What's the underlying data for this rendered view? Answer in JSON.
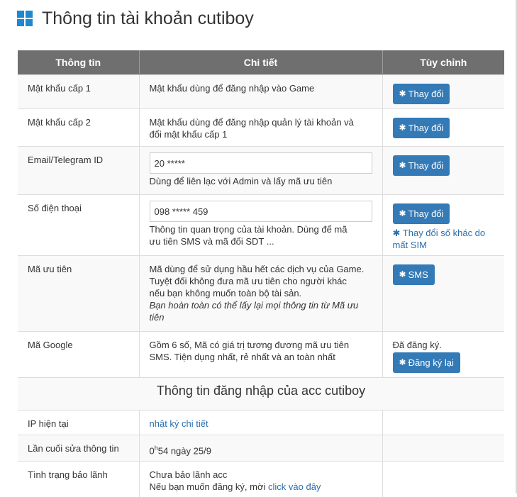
{
  "page": {
    "title": "Thông tin tài khoản cutiboy"
  },
  "columns": [
    "Thông tin",
    "Chi tiết",
    "Tùy chỉnh"
  ],
  "rows": [
    {
      "label": "Mật khẩu cấp 1",
      "detail": "Mật khẩu dùng để đăng nhập vào Game",
      "button": "Thay đổi"
    },
    {
      "label": "Mật khẩu cấp 2",
      "detail_lines": [
        "Mật khẩu dùng để đăng nhập quản lý tài khoản và",
        "đổi mật khẩu cấp 1"
      ],
      "button": "Thay đổi"
    },
    {
      "label": "Email/Telegram ID",
      "input_value": "20 *****",
      "detail": "Dùng để liên lạc với Admin và lấy mã ưu tiên",
      "button": "Thay đổi"
    },
    {
      "label": "Số điện thoại",
      "input_value": "098 ***** 459",
      "detail_lines": [
        "Thông tin quan trọng của tài khoản. Dùng để mã",
        "ưu tiên SMS và mã đổi SDT ..."
      ],
      "button": "Thay đổi",
      "extra_link_lines": [
        "Thay đổi số khác do",
        "mất SIM"
      ]
    },
    {
      "label": "Mã ưu tiên",
      "detail_lines": [
        "Mã dùng để sử dụng hầu hết các dịch vụ của Game.",
        "Tuyệt đối không đưa mã ưu tiên cho người khác",
        "nếu bạn không muốn toàn bộ tài sản."
      ],
      "note_lines": [
        "Bạn hoàn toàn có thể lấy lại mọi thông tin từ Mã ưu",
        "tiên"
      ],
      "button": "SMS"
    },
    {
      "label": "Mã Google",
      "detail_lines": [
        "Gồm 6 số, Mã có giá trị tương đương mã ưu tiên",
        "SMS. Tiện dụng nhất, rẻ nhất và an toàn nhất"
      ],
      "status": "Đã đăng ký.",
      "button": "Đăng ký lại"
    }
  ],
  "login_section": {
    "title": "Thông tin đăng nhập của acc cutiboy",
    "rows": [
      {
        "label": "IP hiện tại",
        "link": "nhật ký chi tiết"
      },
      {
        "label": "Lần cuối sửa thông tin",
        "value_prefix": "0",
        "value_sup": "h",
        "value_suffix": "54 ngày 25/9"
      },
      {
        "label": "Tình trạng bảo lãnh",
        "line1": "Chưa bảo lãnh acc",
        "line2_text": "Nếu bạn muốn đăng ký, mời",
        "line2_link": "click vào đây"
      }
    ]
  },
  "icons": {
    "title_icon": "windows-icon",
    "button_icon": "gear-icon"
  },
  "colors": {
    "button": "#337ab7",
    "header_bg": "#6f6f6f",
    "link": "#2a6eb0",
    "icon": "#1e88d0"
  }
}
